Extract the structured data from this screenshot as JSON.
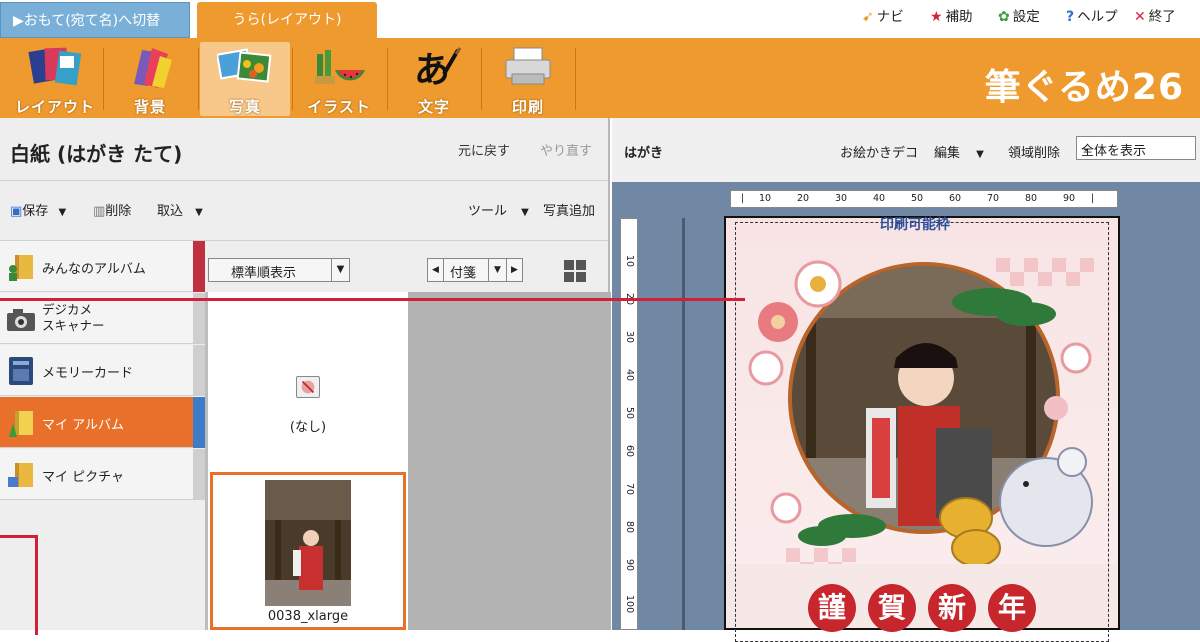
{
  "top_tabs": {
    "front_label": "▶おもて(宛て名)へ切替",
    "back_label": "うら(レイアウト)"
  },
  "top_menu": {
    "navi": "ナビ",
    "help_assist": "補助",
    "settings": "設定",
    "help": "ヘルプ",
    "exit": "終了"
  },
  "toolbar": {
    "tools": [
      "レイアウト",
      "背景",
      "写真",
      "イラスト",
      "文字",
      "印刷"
    ],
    "active_tool": "写真",
    "brand": "筆ぐるめ26"
  },
  "left_panel": {
    "document_title": "白紙 (はがき たて)",
    "undo": "元に戻す",
    "redo": "やり直す",
    "save": "保存",
    "delete": "削除",
    "import": "取込",
    "tools": "ツール",
    "add_photo": "写真追加",
    "albums": [
      {
        "label": "みんなのアルバム",
        "selected": false
      },
      {
        "label": "デジカメ\nスキャナー",
        "selected": false
      },
      {
        "label": "メモリーカード",
        "selected": false
      },
      {
        "label": "マイ アルバム",
        "selected": true
      },
      {
        "label": "マイ ピクチャ",
        "selected": false
      }
    ],
    "sort_value": "標準順表示",
    "tag_value": "付箋",
    "thumbnails": [
      {
        "label": "(なし)"
      },
      {
        "label": "0038_xlarge"
      }
    ]
  },
  "canvas": {
    "paper_type": "はがき",
    "drawing_deco": "お絵かきデコ",
    "edit": "編集",
    "delete_area": "領域削除",
    "zoom_value": "全体を表示",
    "h_ruler_ticks": [
      "10",
      "20",
      "30",
      "40",
      "50",
      "60",
      "70",
      "80",
      "90"
    ],
    "v_ruler_ticks": [
      "10",
      "20",
      "30",
      "40",
      "50",
      "60",
      "70",
      "80",
      "90",
      "100"
    ],
    "print_area_label": "印刷可能枠",
    "greeting_chars": [
      "謹",
      "賀",
      "新",
      "年"
    ]
  },
  "colors": {
    "toolbar_orange": "#ef9a2e",
    "selected_orange": "#e8702a",
    "canvas_blue": "#7188a4",
    "annotation_red": "#d1203a",
    "greeting_red": "#c8262d"
  }
}
